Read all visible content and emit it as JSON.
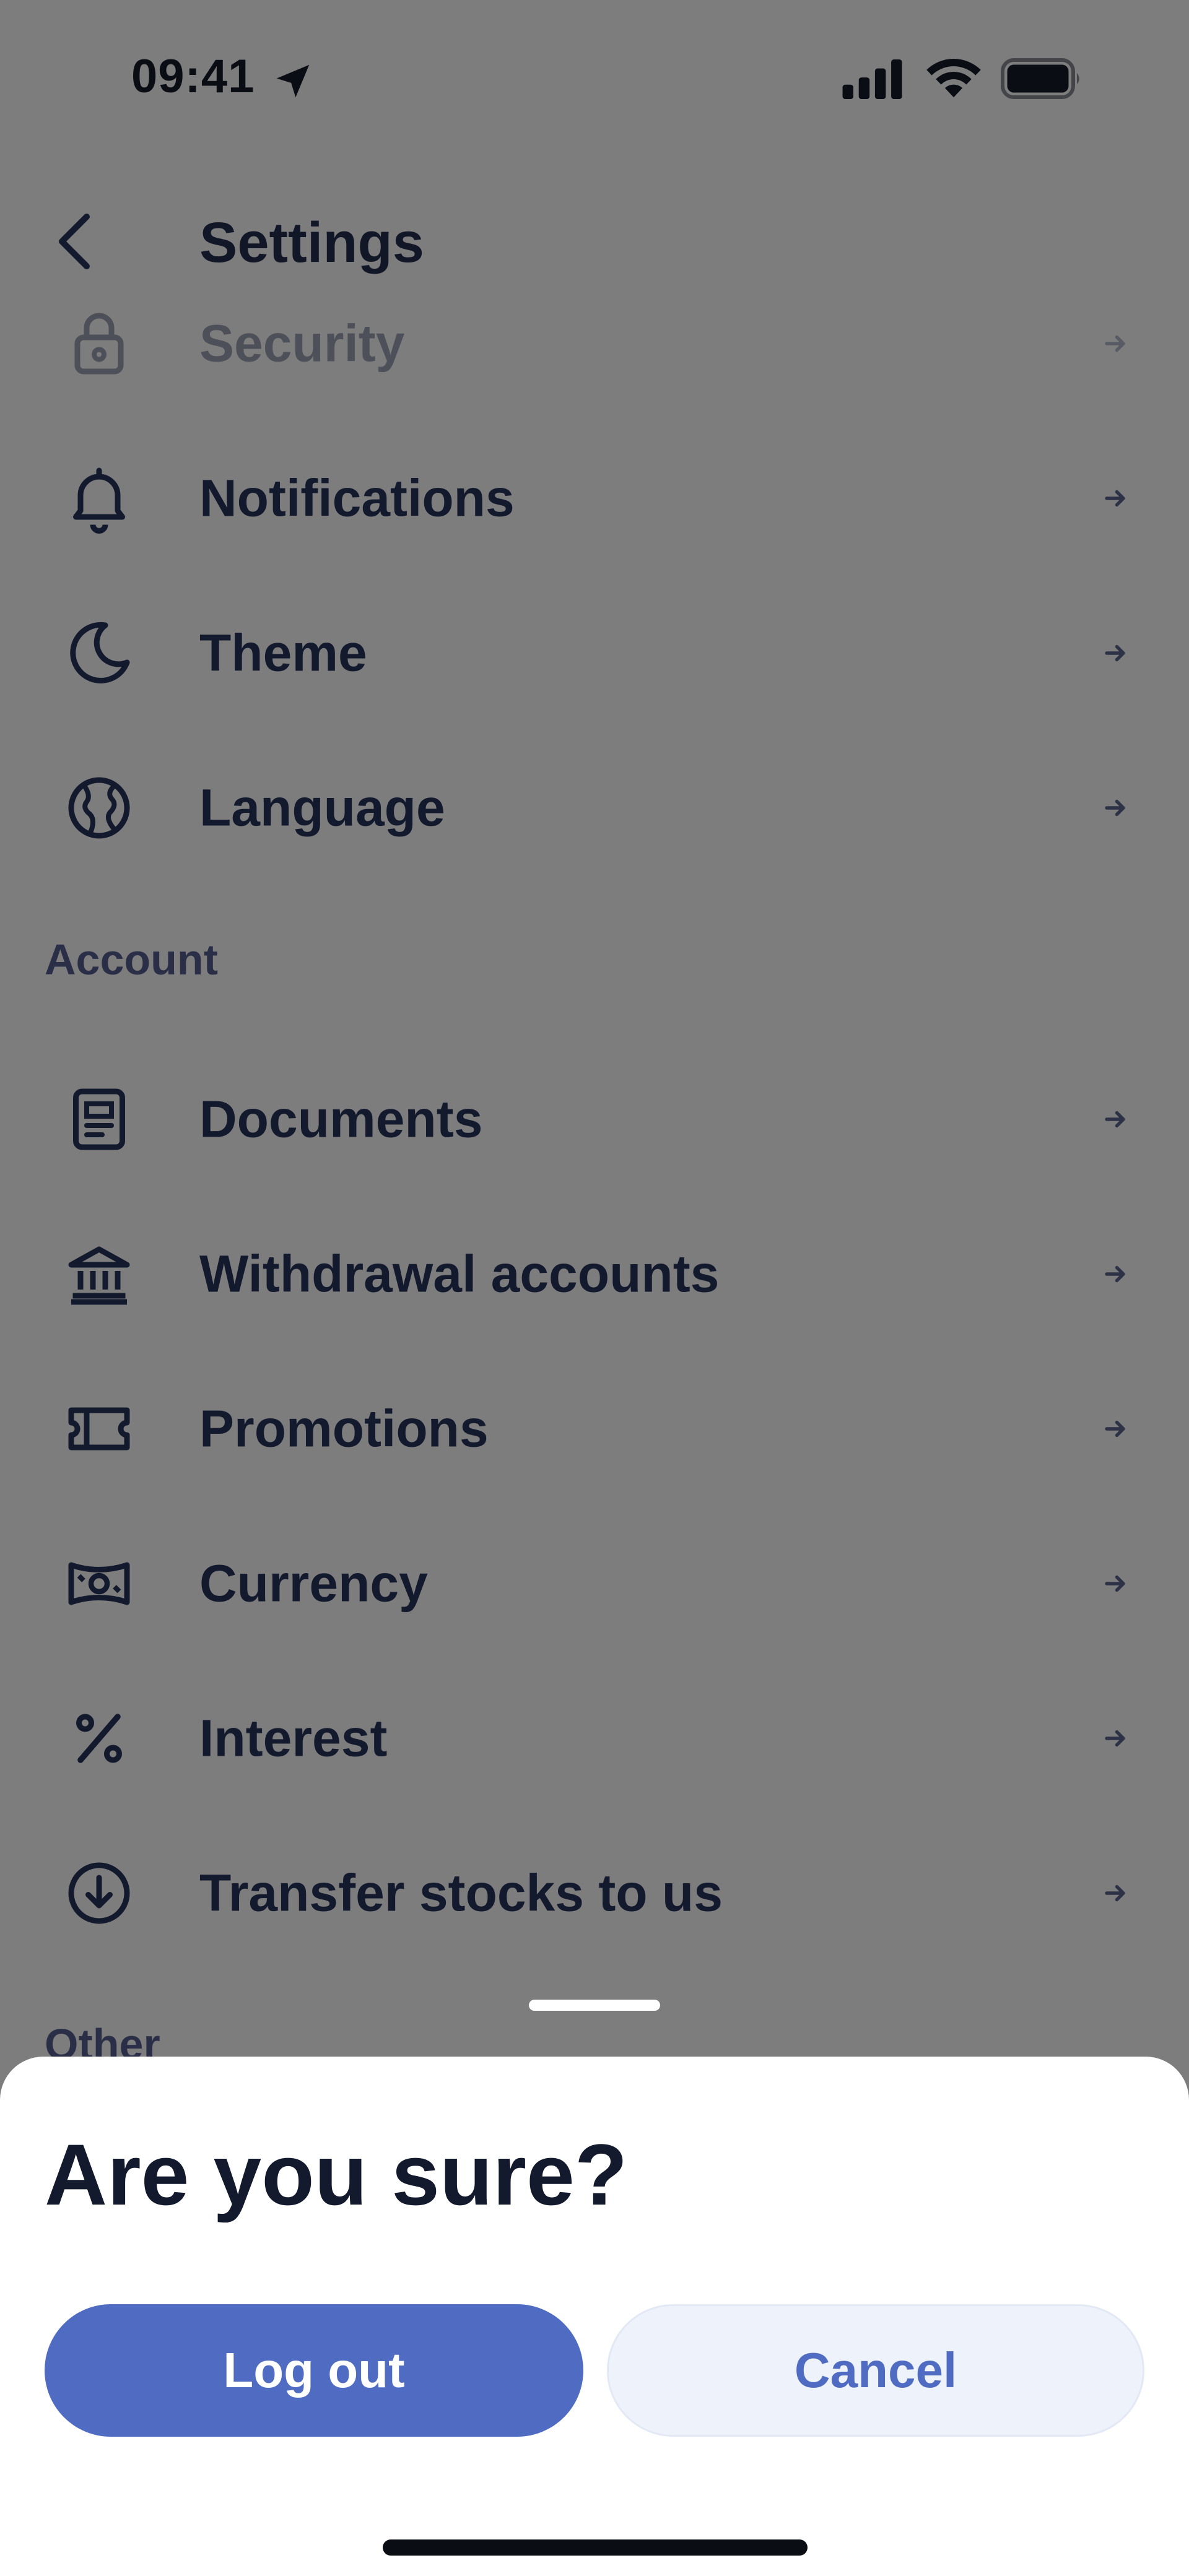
{
  "status_bar": {
    "time": "09:41",
    "icons": [
      "location-arrow-icon",
      "cellular-signal-icon",
      "wifi-icon",
      "battery-icon"
    ]
  },
  "header": {
    "title": "Settings",
    "back_icon": "chevron-left-icon"
  },
  "settings_list": [
    {
      "label": "Security",
      "icon": "lock-icon",
      "faded": true
    },
    {
      "label": "Notifications",
      "icon": "bell-icon"
    },
    {
      "label": "Theme",
      "icon": "moon-icon"
    },
    {
      "label": "Language",
      "icon": "globe-icon"
    }
  ],
  "sections": {
    "account": "Account",
    "other": "Other"
  },
  "account_list": [
    {
      "label": "Documents",
      "icon": "document-icon"
    },
    {
      "label": "Withdrawal accounts",
      "icon": "bank-icon"
    },
    {
      "label": "Promotions",
      "icon": "ticket-icon"
    },
    {
      "label": "Currency",
      "icon": "banknote-icon"
    },
    {
      "label": "Interest",
      "icon": "percent-icon"
    },
    {
      "label": "Transfer stocks to us",
      "icon": "download-circle-icon"
    }
  ],
  "dialog": {
    "title": "Are you sure?",
    "confirm_label": "Log out",
    "cancel_label": "Cancel"
  },
  "colors": {
    "overlay_background": "#7d7d7e",
    "primary": "#4f6cc2",
    "secondary_bg": "#eef2fb",
    "text": "#141a2e"
  }
}
